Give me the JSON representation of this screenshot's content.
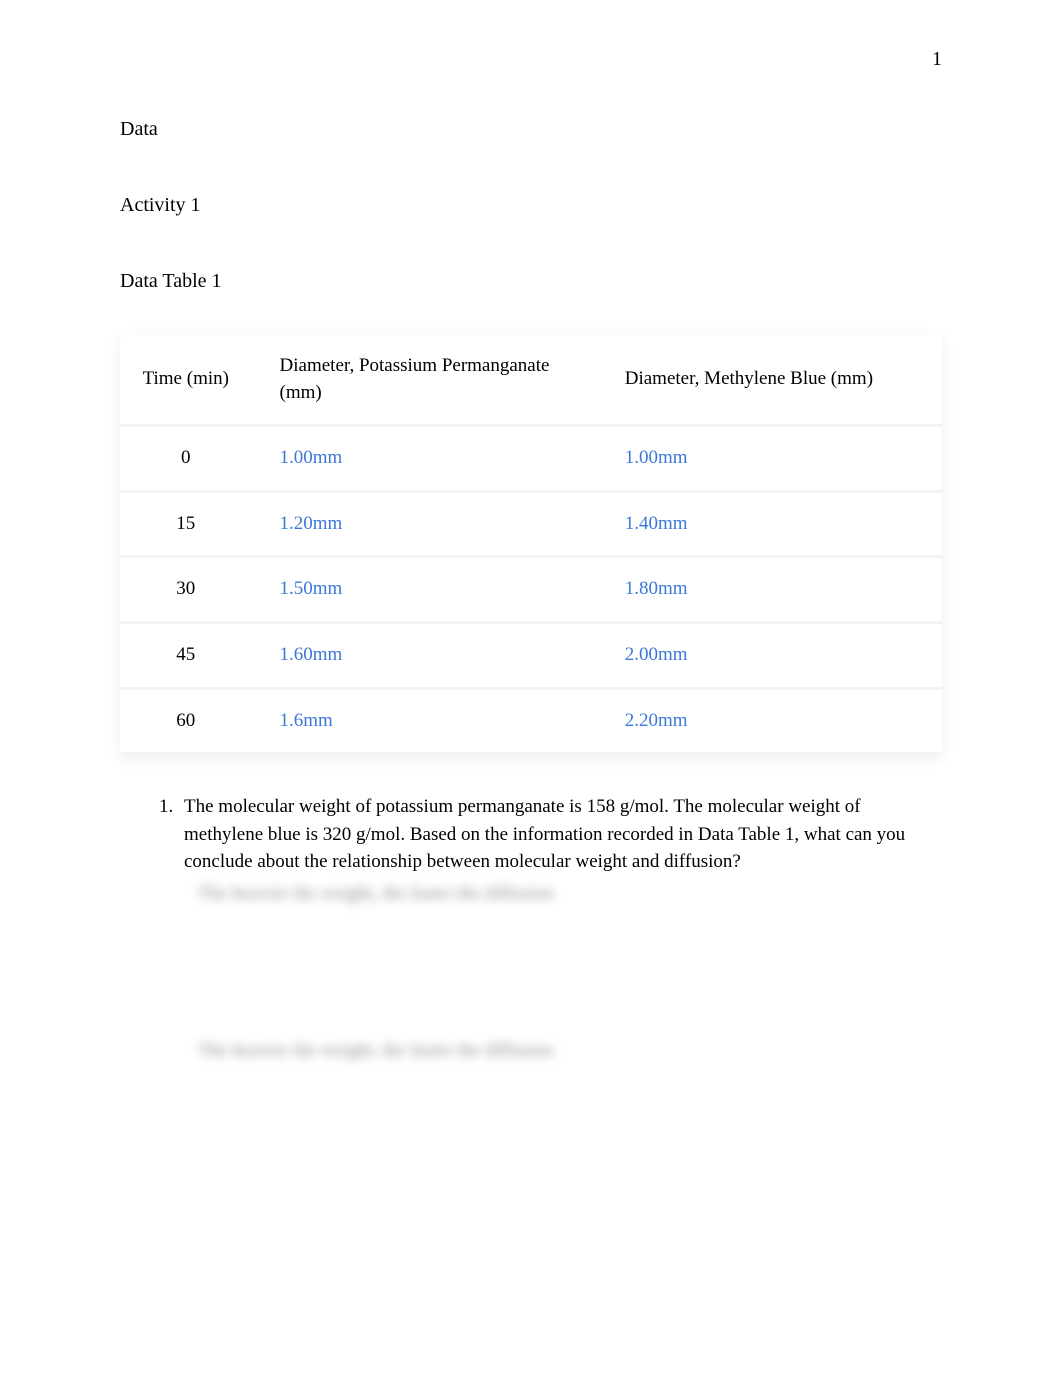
{
  "page_number": "1",
  "headings": {
    "data": "Data",
    "activity": "Activity 1",
    "table": "Data Table 1"
  },
  "table": {
    "headers": {
      "time": "Time (min)",
      "potassium": "Diameter, Potassium Permanganate (mm)",
      "methylene": "Diameter, Methylene Blue (mm)"
    },
    "rows": [
      {
        "time": "0",
        "potassium": "1.00mm",
        "methylene": "1.00mm"
      },
      {
        "time": "15",
        "potassium": "1.20mm",
        "methylene": "1.40mm"
      },
      {
        "time": "30",
        "potassium": "1.50mm",
        "methylene": "1.80mm"
      },
      {
        "time": "45",
        "potassium": "1.60mm",
        "methylene": "2.00mm"
      },
      {
        "time": "60",
        "potassium": "1.6mm",
        "methylene": "2.20mm"
      }
    ]
  },
  "question": {
    "text": "The molecular weight of potassium permanganate is 158 g/mol. The molecular weight of methylene blue is 320 g/mol. Based on the information recorded in Data Table 1, what can you conclude about the relationship between molecular weight and diffusion?",
    "blurred_1": "The heavier the weight, the faster the diffusion",
    "blurred_2": "The heavier the weight, the faster the diffusion"
  }
}
